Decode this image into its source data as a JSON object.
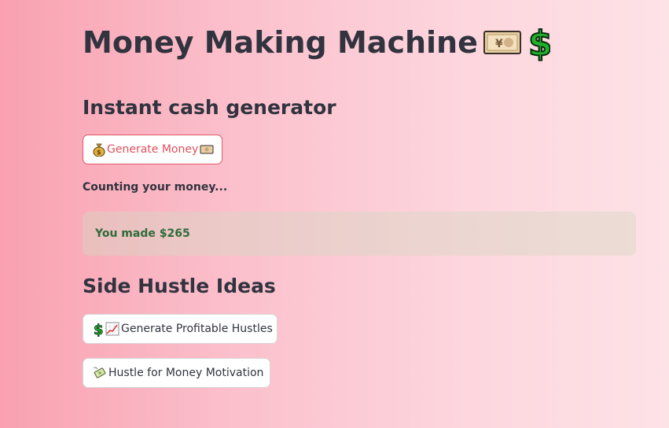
{
  "header": {
    "title": "Money Making Machine",
    "title_icons": [
      "banknote-yen-icon",
      "dollar-sign-icon"
    ]
  },
  "cash_section": {
    "heading": "Instant cash generator",
    "generate_button": {
      "label": "Generate Money",
      "icon_before": "money-bag-icon",
      "icon_after": "banknote-icon"
    },
    "status": "Counting your money...",
    "result": "You made $265"
  },
  "hustle_section": {
    "heading": "Side Hustle Ideas",
    "buttons": [
      {
        "label": "Generate Profitable Hustles",
        "icons": [
          "dollar-sign-icon",
          "chart-increasing-icon"
        ]
      },
      {
        "label": "Hustle for Money Motivation",
        "icons": [
          "money-with-wings-icon"
        ]
      }
    ]
  },
  "colors": {
    "text": "#31333f",
    "active_button_border": "#e05a65",
    "active_button_text": "#e0505c",
    "success_text": "#2f6b3a",
    "dollar_green": "#1fb12c"
  }
}
